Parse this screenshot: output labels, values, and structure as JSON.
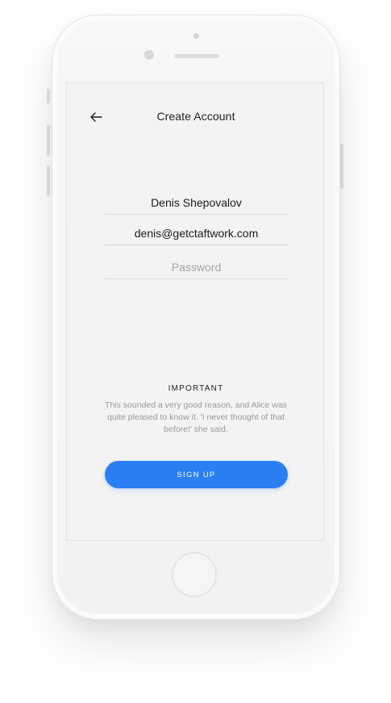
{
  "header": {
    "title": "Create Account",
    "back_icon": "arrow-left-icon"
  },
  "form": {
    "name_value": "Denis Shepovalov",
    "email_value": "denis@getctaftwork.com",
    "password_placeholder": "Password"
  },
  "notice": {
    "title": "IMPORTANT",
    "body": "This sounded a very good reason, and Alice was quite pleased to know it. 'I never thought of that before!' she said."
  },
  "actions": {
    "signup_label": "SIGN UP"
  },
  "colors": {
    "accent": "#2b7ff2",
    "screen_bg": "#f3f3f3"
  }
}
